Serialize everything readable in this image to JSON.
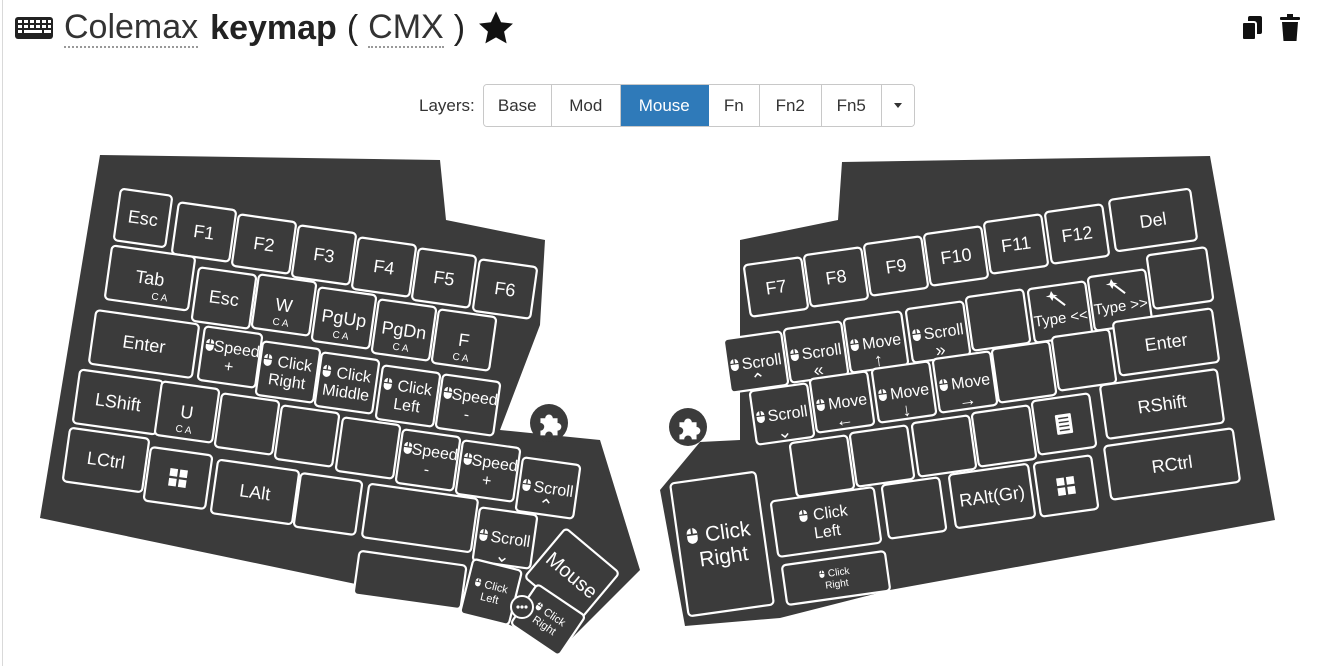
{
  "title": {
    "name": "Colemax",
    "word": "keymap",
    "open_paren": "(",
    "code": "CMX",
    "close_paren": ")"
  },
  "icons": {
    "keyboard": "keyboard-icon",
    "star": "star-icon",
    "copy": "copy-icon",
    "delete": "trash-icon",
    "mouse": "mouse-icon",
    "puzzle": "puzzle-icon",
    "windows": "windows-icon",
    "menu": "menu-key-icon",
    "wand": "magic-wand-icon"
  },
  "layers": {
    "label": "Layers:",
    "tabs": [
      "Base",
      "Mod",
      "Mouse",
      "Fn",
      "Fn2",
      "Fn5"
    ],
    "active": "Mouse",
    "accent": "#2f7ab9"
  },
  "modifier_hint": "C A",
  "left_keys": {
    "esc": "Esc",
    "f1": "F1",
    "f2": "F2",
    "f3": "F3",
    "f4": "F4",
    "f5": "F5",
    "f6": "F6",
    "tab": "Tab",
    "esc2": "Esc",
    "w": "W",
    "pgup": "PgUp",
    "pgdn": "PgDn",
    "f": "F",
    "enter": "Enter",
    "speed_plus": [
      "Speed",
      "+"
    ],
    "click_right": [
      "Click",
      "Right"
    ],
    "click_middle": [
      "Click",
      "Middle"
    ],
    "click_left": [
      "Click",
      "Left"
    ],
    "speed_minus": [
      "Speed",
      "-"
    ],
    "lshift": "LShift",
    "u": "U",
    "lctrl": "LCtrl",
    "lalt": "LAlt",
    "thumb_speed_minus": [
      "Speed",
      "-"
    ],
    "thumb_speed_plus": [
      "Speed",
      "+"
    ],
    "thumb_scroll_up": "Scroll",
    "thumb_scroll_down": "Scroll",
    "thumb_mouse": "Mouse",
    "thumb_click_left": [
      "Click",
      "Left"
    ],
    "thumb_click_right": [
      "Click",
      "Right"
    ]
  },
  "right_keys": {
    "f7": "F7",
    "f8": "F8",
    "f9": "F9",
    "f10": "F10",
    "f11": "F11",
    "f12": "F12",
    "del": "Del",
    "scroll_up": "Scroll",
    "scroll_left": "Scroll",
    "move_up": "Move",
    "scroll_right": "Scroll",
    "type_prev": "Type <<",
    "type_next": "Type >>",
    "enter": "Enter",
    "scroll_down": "Scroll",
    "move_left": "Move",
    "move_down": "Move",
    "move_right": "Move",
    "rshift": "RShift",
    "ralt": "RAlt(Gr)",
    "rctrl": "RCtrl",
    "thumb_click_right": [
      "Click",
      "Right"
    ],
    "thumb_click_left": [
      "Click",
      "Left"
    ],
    "thumb_small_click_right": [
      "Click",
      "Right"
    ]
  }
}
